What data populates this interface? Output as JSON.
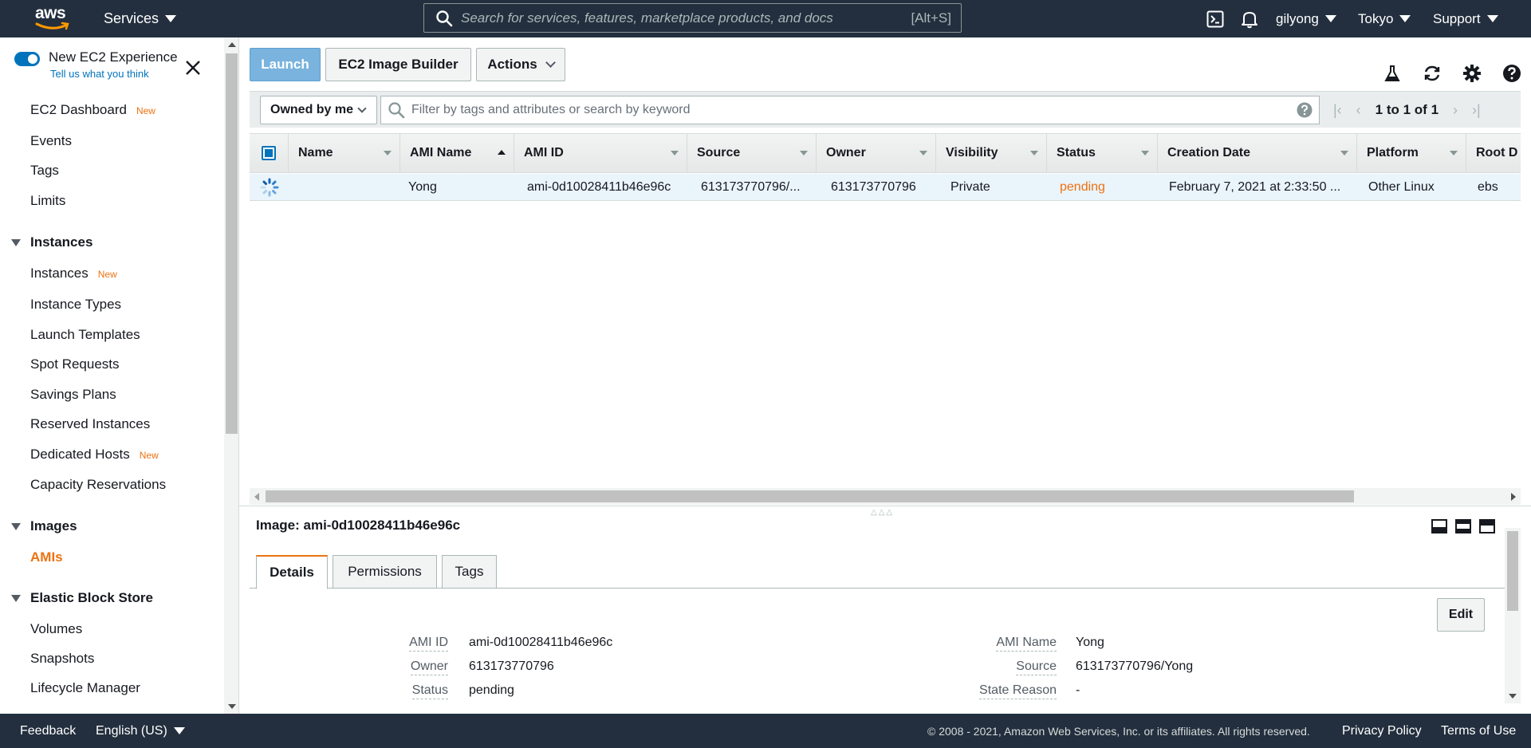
{
  "topnav": {
    "logo_text": "aws",
    "services_label": "Services",
    "search_placeholder": "Search for services, features, marketplace products, and docs",
    "search_shortcut": "[Alt+S]",
    "user": "gilyong",
    "region": "Tokyo",
    "support": "Support",
    "icons": [
      "cloudshell-icon",
      "bell-icon"
    ]
  },
  "sidebar": {
    "experience_title": "New EC2 Experience",
    "experience_sub": "Tell us what you think",
    "new_badge": "New",
    "items_top": [
      {
        "label": "EC2 Dashboard",
        "new": true
      },
      {
        "label": "Events"
      },
      {
        "label": "Tags"
      },
      {
        "label": "Limits"
      }
    ],
    "sections": [
      {
        "title": "Instances",
        "items": [
          {
            "label": "Instances",
            "new": true
          },
          {
            "label": "Instance Types"
          },
          {
            "label": "Launch Templates"
          },
          {
            "label": "Spot Requests"
          },
          {
            "label": "Savings Plans"
          },
          {
            "label": "Reserved Instances"
          },
          {
            "label": "Dedicated Hosts",
            "new": true
          },
          {
            "label": "Capacity Reservations"
          }
        ]
      },
      {
        "title": "Images",
        "items": [
          {
            "label": "AMIs",
            "active": true
          }
        ]
      },
      {
        "title": "Elastic Block Store",
        "items": [
          {
            "label": "Volumes"
          },
          {
            "label": "Snapshots"
          },
          {
            "label": "Lifecycle Manager"
          }
        ]
      }
    ]
  },
  "toolbar": {
    "launch": "Launch",
    "image_builder": "EC2 Image Builder",
    "actions": "Actions"
  },
  "filter": {
    "owned": "Owned by me",
    "placeholder": "Filter by tags and attributes or search by keyword",
    "page_count": "1 to 1 of 1"
  },
  "table": {
    "columns": [
      "Name",
      "AMI Name",
      "AMI ID",
      "Source",
      "Owner",
      "Visibility",
      "Status",
      "Creation Date",
      "Platform",
      "Root D"
    ],
    "rows": [
      {
        "name": "",
        "ami_name": "Yong",
        "ami_id": "ami-0d10028411b46e96c",
        "source": "613173770796/...",
        "owner": "613173770796",
        "visibility": "Private",
        "status": "pending",
        "creation_date": "February 7, 2021 at 2:33:50 ...",
        "platform": "Other Linux",
        "root": "ebs"
      }
    ]
  },
  "details": {
    "title": "Image: ami-0d10028411b46e96c",
    "tabs": [
      "Details",
      "Permissions",
      "Tags"
    ],
    "edit": "Edit",
    "left": [
      {
        "label": "AMI ID",
        "value": "ami-0d10028411b46e96c"
      },
      {
        "label": "Owner",
        "value": "613173770796"
      },
      {
        "label": "Status",
        "value": "pending"
      }
    ],
    "right": [
      {
        "label": "AMI Name",
        "value": "Yong"
      },
      {
        "label": "Source",
        "value": "613173770796/Yong"
      },
      {
        "label": "State Reason",
        "value": "-"
      }
    ]
  },
  "footer": {
    "feedback": "Feedback",
    "language": "English (US)",
    "copyright": "© 2008 - 2021, Amazon Web Services, Inc. or its affiliates. All rights reserved.",
    "privacy": "Privacy Policy",
    "terms": "Terms of Use"
  },
  "colors": {
    "nav_bg": "#232f3e",
    "accent_orange": "#ec7211",
    "link_blue": "#0073bb",
    "primary_button": "#79b3de"
  }
}
